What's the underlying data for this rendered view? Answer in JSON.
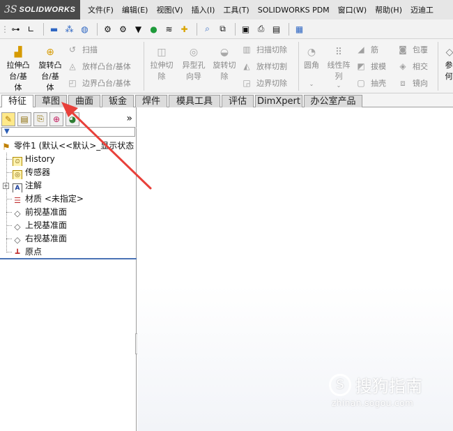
{
  "app": {
    "logo_prefix": "3S",
    "logo_name": "SOLIDWORKS"
  },
  "menu": [
    "文件(F)",
    "编辑(E)",
    "视图(V)",
    "插入(I)",
    "工具(T)",
    "SOLIDWORKS PDM",
    "窗口(W)",
    "帮助(H)",
    "迈迪工"
  ],
  "command_manager": {
    "extrude_boss": "拉伸凸\n台/基\n体",
    "revolve_boss": "旋转凸\n台/基\n体",
    "sweep": "扫描",
    "loft": "放样凸台/基体",
    "boundary_boss": "边界凸台/基体",
    "extrude_cut": "拉伸切\n除",
    "hole_wizard": "异型孔\n向导",
    "revolve_cut": "旋转切\n除",
    "swept_cut": "扫描切除",
    "lofted_cut": "放样切割",
    "boundary_cut": "边界切除",
    "fillet": "圆角",
    "linear_pattern": "线性阵\n列",
    "rib": "筋",
    "draft": "拔模",
    "shell": "抽壳",
    "wrap": "包覆",
    "intersect": "相交",
    "mirror": "镜向",
    "reference_geometry": "参\n何"
  },
  "tabs": [
    "特征",
    "草图",
    "曲面",
    "钣金",
    "焊件",
    "模具工具",
    "评估",
    "DimXpert",
    "办公室产品"
  ],
  "active_tab": "特征",
  "feature_tree": {
    "part": "零件1 (默认<<默认>_显示状态",
    "items": [
      "History",
      "传感器",
      "注解",
      "材质 <未指定>",
      "前视基准面",
      "上视基准面",
      "右视基准面",
      "原点"
    ]
  },
  "panel_chevron": "»",
  "watermark": {
    "text": "搜狗指南",
    "url": "zhinan.sogou.com"
  },
  "colors": {
    "arrow": "#e8403a",
    "selection_line": "#4a72b5",
    "logo_bg": "#4a4a4a"
  }
}
